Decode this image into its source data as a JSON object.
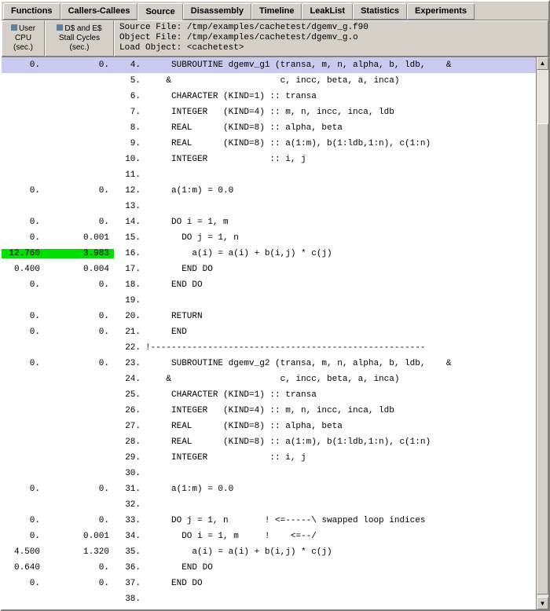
{
  "tabs": [
    "Functions",
    "Callers-Callees",
    "Source",
    "Disassembly",
    "Timeline",
    "LeakList",
    "Statistics",
    "Experiments"
  ],
  "activeTab": 2,
  "headers": {
    "usercpu": {
      "l1": "User",
      "l2": "CPU",
      "l3": "(sec.)"
    },
    "stall": {
      "l1": "D$ and E$",
      "l2": "Stall Cycles",
      "l3": "(sec.)"
    },
    "srcinfo": {
      "l1": "Source File: /tmp/examples/cachetest/dgemv_g.f90",
      "l2": "Object File: /tmp/examples/cachetest/dgemv_g.o",
      "l3": "Load Object: <cachetest>"
    }
  },
  "scrollbar": {
    "thumbTop": 68,
    "thumbHeight": 600
  },
  "rows": [
    {
      "cpu": "0.",
      "stall": "0.",
      "ln": "4.",
      "code": "     SUBROUTINE dgemv_g1 (transa, m, n, alpha, b, ldb,    &",
      "sel": true
    },
    {
      "cpu": "",
      "stall": "",
      "ln": "5.",
      "code": "    &                     c, incc, beta, a, inca)"
    },
    {
      "cpu": "",
      "stall": "",
      "ln": "6.",
      "code": "     CHARACTER (KIND=1) :: transa"
    },
    {
      "cpu": "",
      "stall": "",
      "ln": "7.",
      "code": "     INTEGER   (KIND=4) :: m, n, incc, inca, ldb"
    },
    {
      "cpu": "",
      "stall": "",
      "ln": "8.",
      "code": "     REAL      (KIND=8) :: alpha, beta"
    },
    {
      "cpu": "",
      "stall": "",
      "ln": "9.",
      "code": "     REAL      (KIND=8) :: a(1:m), b(1:ldb,1:n), c(1:n)"
    },
    {
      "cpu": "",
      "stall": "",
      "ln": "10.",
      "code": "     INTEGER            :: i, j"
    },
    {
      "cpu": "",
      "stall": "",
      "ln": "11.",
      "code": ""
    },
    {
      "cpu": "0.",
      "stall": "0.",
      "ln": "12.",
      "code": "     a(1:m) = 0.0"
    },
    {
      "cpu": "",
      "stall": "",
      "ln": "13.",
      "code": ""
    },
    {
      "cpu": "0.",
      "stall": "0.",
      "ln": "14.",
      "code": "     DO i = 1, m"
    },
    {
      "cpu": "0.",
      "stall": "0.001",
      "ln": "15.",
      "code": "       DO j = 1, n"
    },
    {
      "cpu": "12.760",
      "stall": "3.983",
      "ln": "16.",
      "code": "         a(i) = a(i) + b(i,j) * c(j)",
      "hot": true
    },
    {
      "cpu": "0.400",
      "stall": "0.004",
      "ln": "17.",
      "code": "       END DO"
    },
    {
      "cpu": "0.",
      "stall": "0.",
      "ln": "18.",
      "code": "     END DO"
    },
    {
      "cpu": "",
      "stall": "",
      "ln": "19.",
      "code": ""
    },
    {
      "cpu": "0.",
      "stall": "0.",
      "ln": "20.",
      "code": "     RETURN"
    },
    {
      "cpu": "0.",
      "stall": "0.",
      "ln": "21.",
      "code": "     END"
    },
    {
      "cpu": "",
      "stall": "",
      "ln": "22.",
      "code": "!-----------------------------------------------------"
    },
    {
      "cpu": "0.",
      "stall": "0.",
      "ln": "23.",
      "code": "     SUBROUTINE dgemv_g2 (transa, m, n, alpha, b, ldb,    &"
    },
    {
      "cpu": "",
      "stall": "",
      "ln": "24.",
      "code": "    &                     c, incc, beta, a, inca)"
    },
    {
      "cpu": "",
      "stall": "",
      "ln": "25.",
      "code": "     CHARACTER (KIND=1) :: transa"
    },
    {
      "cpu": "",
      "stall": "",
      "ln": "26.",
      "code": "     INTEGER   (KIND=4) :: m, n, incc, inca, ldb"
    },
    {
      "cpu": "",
      "stall": "",
      "ln": "27.",
      "code": "     REAL      (KIND=8) :: alpha, beta"
    },
    {
      "cpu": "",
      "stall": "",
      "ln": "28.",
      "code": "     REAL      (KIND=8) :: a(1:m), b(1:ldb,1:n), c(1:n)"
    },
    {
      "cpu": "",
      "stall": "",
      "ln": "29.",
      "code": "     INTEGER            :: i, j"
    },
    {
      "cpu": "",
      "stall": "",
      "ln": "30.",
      "code": ""
    },
    {
      "cpu": "0.",
      "stall": "0.",
      "ln": "31.",
      "code": "     a(1:m) = 0.0"
    },
    {
      "cpu": "",
      "stall": "",
      "ln": "32.",
      "code": ""
    },
    {
      "cpu": "0.",
      "stall": "0.",
      "ln": "33.",
      "code": "     DO j = 1, n       ! <=-----\\ swapped loop indices"
    },
    {
      "cpu": "0.",
      "stall": "0.001",
      "ln": "34.",
      "code": "       DO i = 1, m     !    <=--/"
    },
    {
      "cpu": "4.500",
      "stall": "1.320",
      "ln": "35.",
      "code": "         a(i) = a(i) + b(i,j) * c(j)"
    },
    {
      "cpu": "0.640",
      "stall": "0.",
      "ln": "36.",
      "code": "       END DO"
    },
    {
      "cpu": "0.",
      "stall": "0.",
      "ln": "37.",
      "code": "     END DO"
    },
    {
      "cpu": "",
      "stall": "",
      "ln": "38.",
      "code": ""
    }
  ]
}
